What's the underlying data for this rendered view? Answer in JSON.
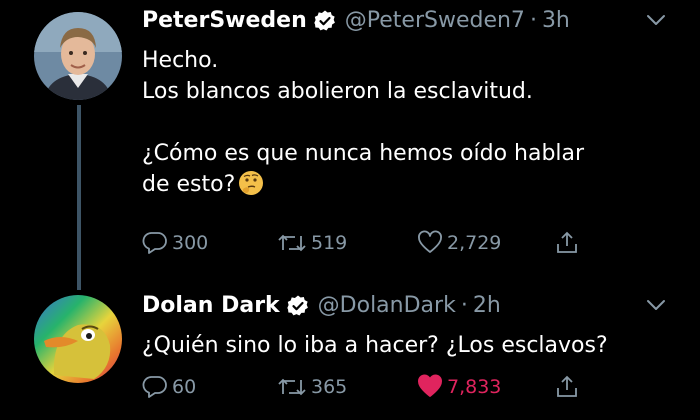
{
  "tweets": [
    {
      "display_name": "PeterSweden",
      "handle": "@PeterSweden7",
      "separator": "·",
      "time": "3h",
      "text": "Hecho.\nLos blancos abolieron la esclavitud.\n\n¿Cómo es que nunca hemos oído hablar\nde esto?",
      "replies": "300",
      "retweets": "519",
      "likes": "2,729",
      "liked": false
    },
    {
      "display_name": "Dolan Dark",
      "handle": "@DolanDark",
      "separator": "·",
      "time": "2h",
      "text": "¿Quién sino lo iba a hacer? ¿Los esclavos?",
      "replies": "60",
      "retweets": "365",
      "likes": "7,833",
      "liked": true
    }
  ],
  "icons": {
    "verified": "verified-badge-icon",
    "menu": "chevron-down-icon",
    "reply": "reply-icon",
    "retweet": "retweet-icon",
    "like": "heart-icon",
    "share": "share-icon",
    "emoji": "thinking-face-emoji"
  },
  "colors": {
    "background": "#000000",
    "text": "#ffffff",
    "secondary": "#8899a6",
    "like_active": "#e0245e",
    "thread_line": "#3d5466"
  }
}
